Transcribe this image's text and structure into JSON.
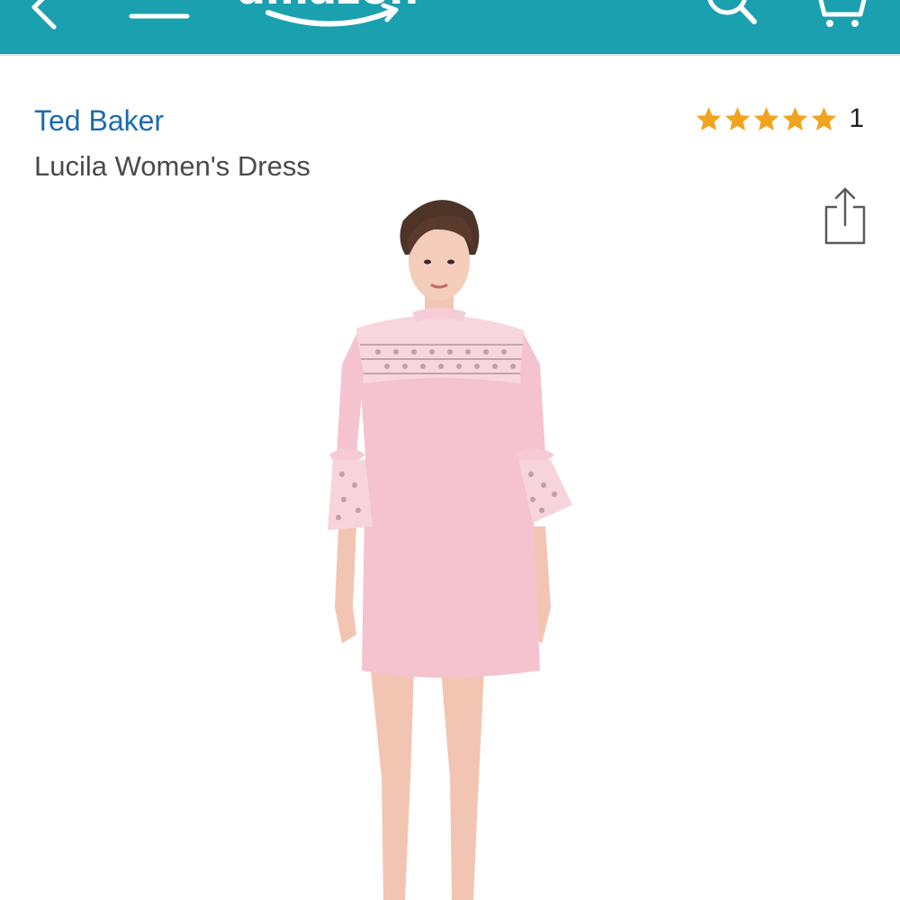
{
  "topbar": {
    "background": "#1aa0ae",
    "back_icon": "chevron-left-icon",
    "menu_icon": "hamburger-menu-icon",
    "logo_text": "amazon",
    "search_icon": "search-icon",
    "cart_icon": "cart-icon"
  },
  "product": {
    "brand": "Ted Baker",
    "title": "Lucila Women's Dress",
    "rating_stars": 5,
    "rating_max": 5,
    "rating_count": "1",
    "star_color": "#f0a41e",
    "share_icon": "share-icon",
    "dress_color": "#f4c3cf"
  }
}
